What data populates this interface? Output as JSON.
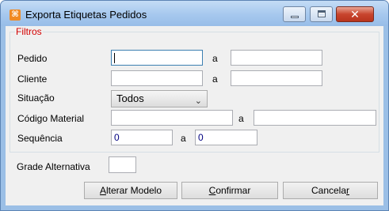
{
  "window": {
    "title": "Exporta Etiquetas Pedidos",
    "icon": "app-icon",
    "controls": {
      "minimize": "minimize-icon",
      "maximize": "maximize-icon",
      "close": "close-icon"
    }
  },
  "filters": {
    "group_title": "Filtros",
    "pedido": {
      "label": "Pedido",
      "from": "",
      "separator": "a",
      "to": ""
    },
    "cliente": {
      "label": "Cliente",
      "from": "",
      "separator": "a",
      "to": ""
    },
    "situacao": {
      "label": "Situação",
      "selected": "Todos"
    },
    "codigo_material": {
      "label": "Código Material",
      "from": "",
      "separator": "a",
      "to": ""
    },
    "sequencia": {
      "label": "Sequência",
      "from": "0",
      "separator": "a",
      "to": "0"
    }
  },
  "grade": {
    "label": "Grade Alternativa",
    "value": ""
  },
  "buttons": {
    "alterar_key": "A",
    "alterar_rest": "lterar Modelo",
    "confirmar_key": "C",
    "confirmar_rest": "onfirmar",
    "cancelar_main": "Cancela",
    "cancelar_key": "r"
  }
}
